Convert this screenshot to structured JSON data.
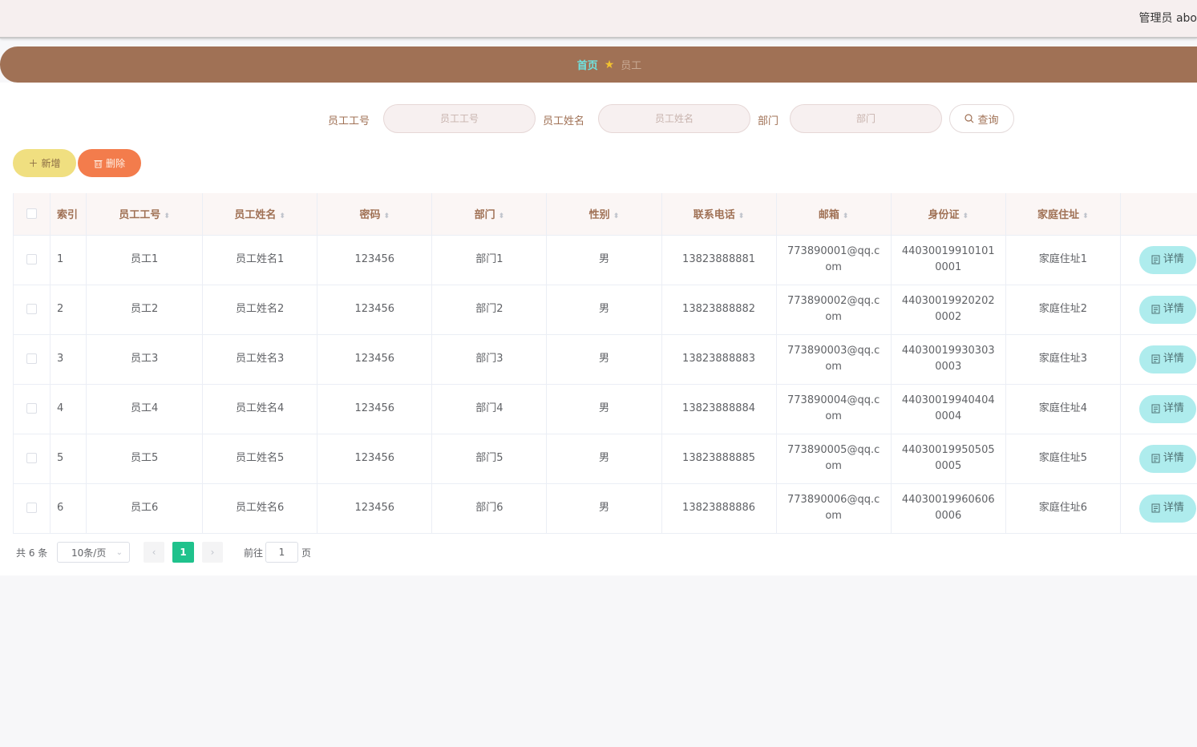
{
  "header": {
    "user_text": "管理员 abo"
  },
  "breadcrumb": {
    "home": "首页",
    "current": "员工"
  },
  "search": {
    "no_label": "员工工号",
    "no_placeholder": "员工工号",
    "name_label": "员工姓名",
    "name_placeholder": "员工姓名",
    "dept_label": "部门",
    "dept_placeholder": "部门",
    "query_label": "查询"
  },
  "actions": {
    "add_label": "新增",
    "delete_label": "删除"
  },
  "table": {
    "columns": [
      "索引",
      "员工工号",
      "员工姓名",
      "密码",
      "部门",
      "性别",
      "联系电话",
      "邮箱",
      "身份证",
      "家庭住址"
    ],
    "rows": [
      {
        "index": "1",
        "no": "员工1",
        "name": "员工姓名1",
        "password": "123456",
        "dept": "部门1",
        "gender": "男",
        "phone": "13823888881",
        "email": "773890001@qq.com",
        "idcard": "440300199101010001",
        "address": "家庭住址1"
      },
      {
        "index": "2",
        "no": "员工2",
        "name": "员工姓名2",
        "password": "123456",
        "dept": "部门2",
        "gender": "男",
        "phone": "13823888882",
        "email": "773890002@qq.com",
        "idcard": "440300199202020002",
        "address": "家庭住址2"
      },
      {
        "index": "3",
        "no": "员工3",
        "name": "员工姓名3",
        "password": "123456",
        "dept": "部门3",
        "gender": "男",
        "phone": "13823888883",
        "email": "773890003@qq.com",
        "idcard": "440300199303030003",
        "address": "家庭住址3"
      },
      {
        "index": "4",
        "no": "员工4",
        "name": "员工姓名4",
        "password": "123456",
        "dept": "部门4",
        "gender": "男",
        "phone": "13823888884",
        "email": "773890004@qq.com",
        "idcard": "440300199404040004",
        "address": "家庭住址4"
      },
      {
        "index": "5",
        "no": "员工5",
        "name": "员工姓名5",
        "password": "123456",
        "dept": "部门5",
        "gender": "男",
        "phone": "13823888885",
        "email": "773890005@qq.com",
        "idcard": "440300199505050005",
        "address": "家庭住址5"
      },
      {
        "index": "6",
        "no": "员工6",
        "name": "员工姓名6",
        "password": "123456",
        "dept": "部门6",
        "gender": "男",
        "phone": "13823888886",
        "email": "773890006@qq.com",
        "idcard": "440300199606060006",
        "address": "家庭住址6"
      }
    ],
    "detail_label": "详情"
  },
  "pagination": {
    "total_text": "共 6 条",
    "page_size": "10条/页",
    "current_page": "1",
    "goto_label": "前往",
    "goto_value": "1",
    "page_suffix": "页"
  },
  "colors": {
    "brand": "#a07155",
    "accent": "#1fc28c",
    "detail_button": "#aeeced",
    "add_button": "#f0df80",
    "delete_button": "#f37c4c"
  }
}
